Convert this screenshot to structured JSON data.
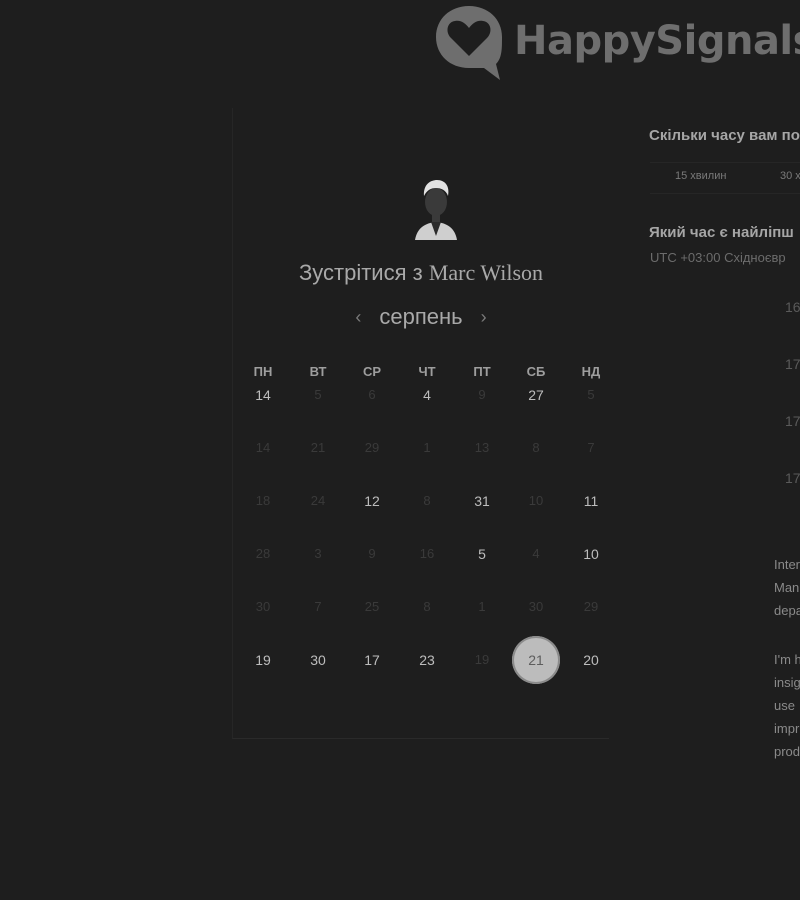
{
  "logo": {
    "text": "HappySignals"
  },
  "booking": {
    "title_prefix": "Зустрітися з",
    "host_name": "Marc Wilson",
    "month": "серпень",
    "weekdays": [
      "ПН",
      "ВТ",
      "СР",
      "ЧТ",
      "ПТ",
      "СБ",
      "НД"
    ],
    "weeks": [
      [
        {
          "d": "14",
          "a": true
        },
        {
          "d": "5",
          "a": false
        },
        {
          "d": "6",
          "a": false
        },
        {
          "d": "4",
          "a": true
        },
        {
          "d": "9",
          "a": false
        },
        {
          "d": "27",
          "a": true
        },
        {
          "d": "5",
          "a": false
        }
      ],
      [
        {
          "d": "14",
          "a": false
        },
        {
          "d": "21",
          "a": false
        },
        {
          "d": "29",
          "a": false
        },
        {
          "d": "1",
          "a": false
        },
        {
          "d": "13",
          "a": false
        },
        {
          "d": "8",
          "a": false
        },
        {
          "d": "7",
          "a": false
        }
      ],
      [
        {
          "d": "18",
          "a": false
        },
        {
          "d": "24",
          "a": false
        },
        {
          "d": "12",
          "a": true
        },
        {
          "d": "8",
          "a": false
        },
        {
          "d": "31",
          "a": true
        },
        {
          "d": "10",
          "a": false
        },
        {
          "d": "11",
          "a": true
        }
      ],
      [
        {
          "d": "28",
          "a": false
        },
        {
          "d": "3",
          "a": false
        },
        {
          "d": "9",
          "a": false
        },
        {
          "d": "16",
          "a": false
        },
        {
          "d": "5",
          "a": true
        },
        {
          "d": "4",
          "a": false
        },
        {
          "d": "10",
          "a": true
        }
      ],
      [
        {
          "d": "30",
          "a": false
        },
        {
          "d": "7",
          "a": false
        },
        {
          "d": "25",
          "a": false
        },
        {
          "d": "8",
          "a": false
        },
        {
          "d": "1",
          "a": false
        },
        {
          "d": "30",
          "a": false
        },
        {
          "d": "29",
          "a": false
        }
      ],
      [
        {
          "d": "19",
          "a": true
        },
        {
          "d": "30",
          "a": true
        },
        {
          "d": "17",
          "a": true
        },
        {
          "d": "23",
          "a": true
        },
        {
          "d": "19",
          "a": false
        },
        {
          "d": "21",
          "a": true,
          "selected": true
        },
        {
          "d": "20",
          "a": true
        }
      ]
    ]
  },
  "right": {
    "question_duration": "Скільки часу вам по",
    "durations": [
      "15 хвилин",
      "30 х"
    ],
    "question_time": "Який час є найліпш",
    "timezone": "UTC +03:00 Східноєвр",
    "slots": [
      "16",
      "17",
      "17",
      "17"
    ],
    "description_lines": [
      "Inter",
      "Man",
      "depa",
      "",
      "I'm h",
      "insig",
      "use",
      "impr",
      "prod"
    ]
  },
  "colors": {
    "background": "#1e1e1e",
    "selected_day": "#bcbcbc",
    "logo": "#6e6e6e"
  }
}
